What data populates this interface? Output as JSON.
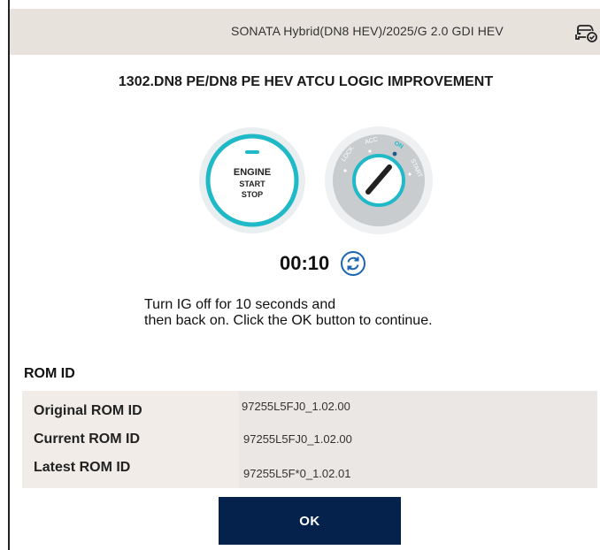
{
  "header": {
    "vehicle": "SONATA Hybrid(DN8 HEV)/2025/G 2.0 GDI HEV",
    "icon": "car-check-icon"
  },
  "procedure": {
    "title": "1302.DN8 PE/DN8 PE HEV ATCU LOGIC IMPROVEMENT"
  },
  "engine_button": {
    "line1": "ENGINE",
    "line2": "START",
    "line3": "STOP"
  },
  "ignition": {
    "positions": [
      "LOCK",
      "ACC",
      "ON",
      "START"
    ],
    "active_position": "ON"
  },
  "timer": {
    "value": "00:10",
    "refresh_icon": "refresh-icon"
  },
  "instruction": {
    "line1": "Turn IG off for 10 seconds and",
    "line2": "then back on. Click the OK button to continue."
  },
  "rom": {
    "heading": "ROM ID",
    "rows": [
      {
        "label": "Original ROM ID",
        "value": "97255L5FJ0_1.02.00"
      },
      {
        "label": "Current ROM ID",
        "value": "97255L5FJ0_1.02.00"
      },
      {
        "label": "Latest ROM ID",
        "value": "97255L5F*0_1.02.01"
      }
    ]
  },
  "actions": {
    "ok_label": "OK"
  },
  "colors": {
    "header_bg": "#e8e2dc",
    "button_navy": "#04224b",
    "accent_teal": "#20b9c8",
    "rom_bg": "#f1ece8"
  }
}
